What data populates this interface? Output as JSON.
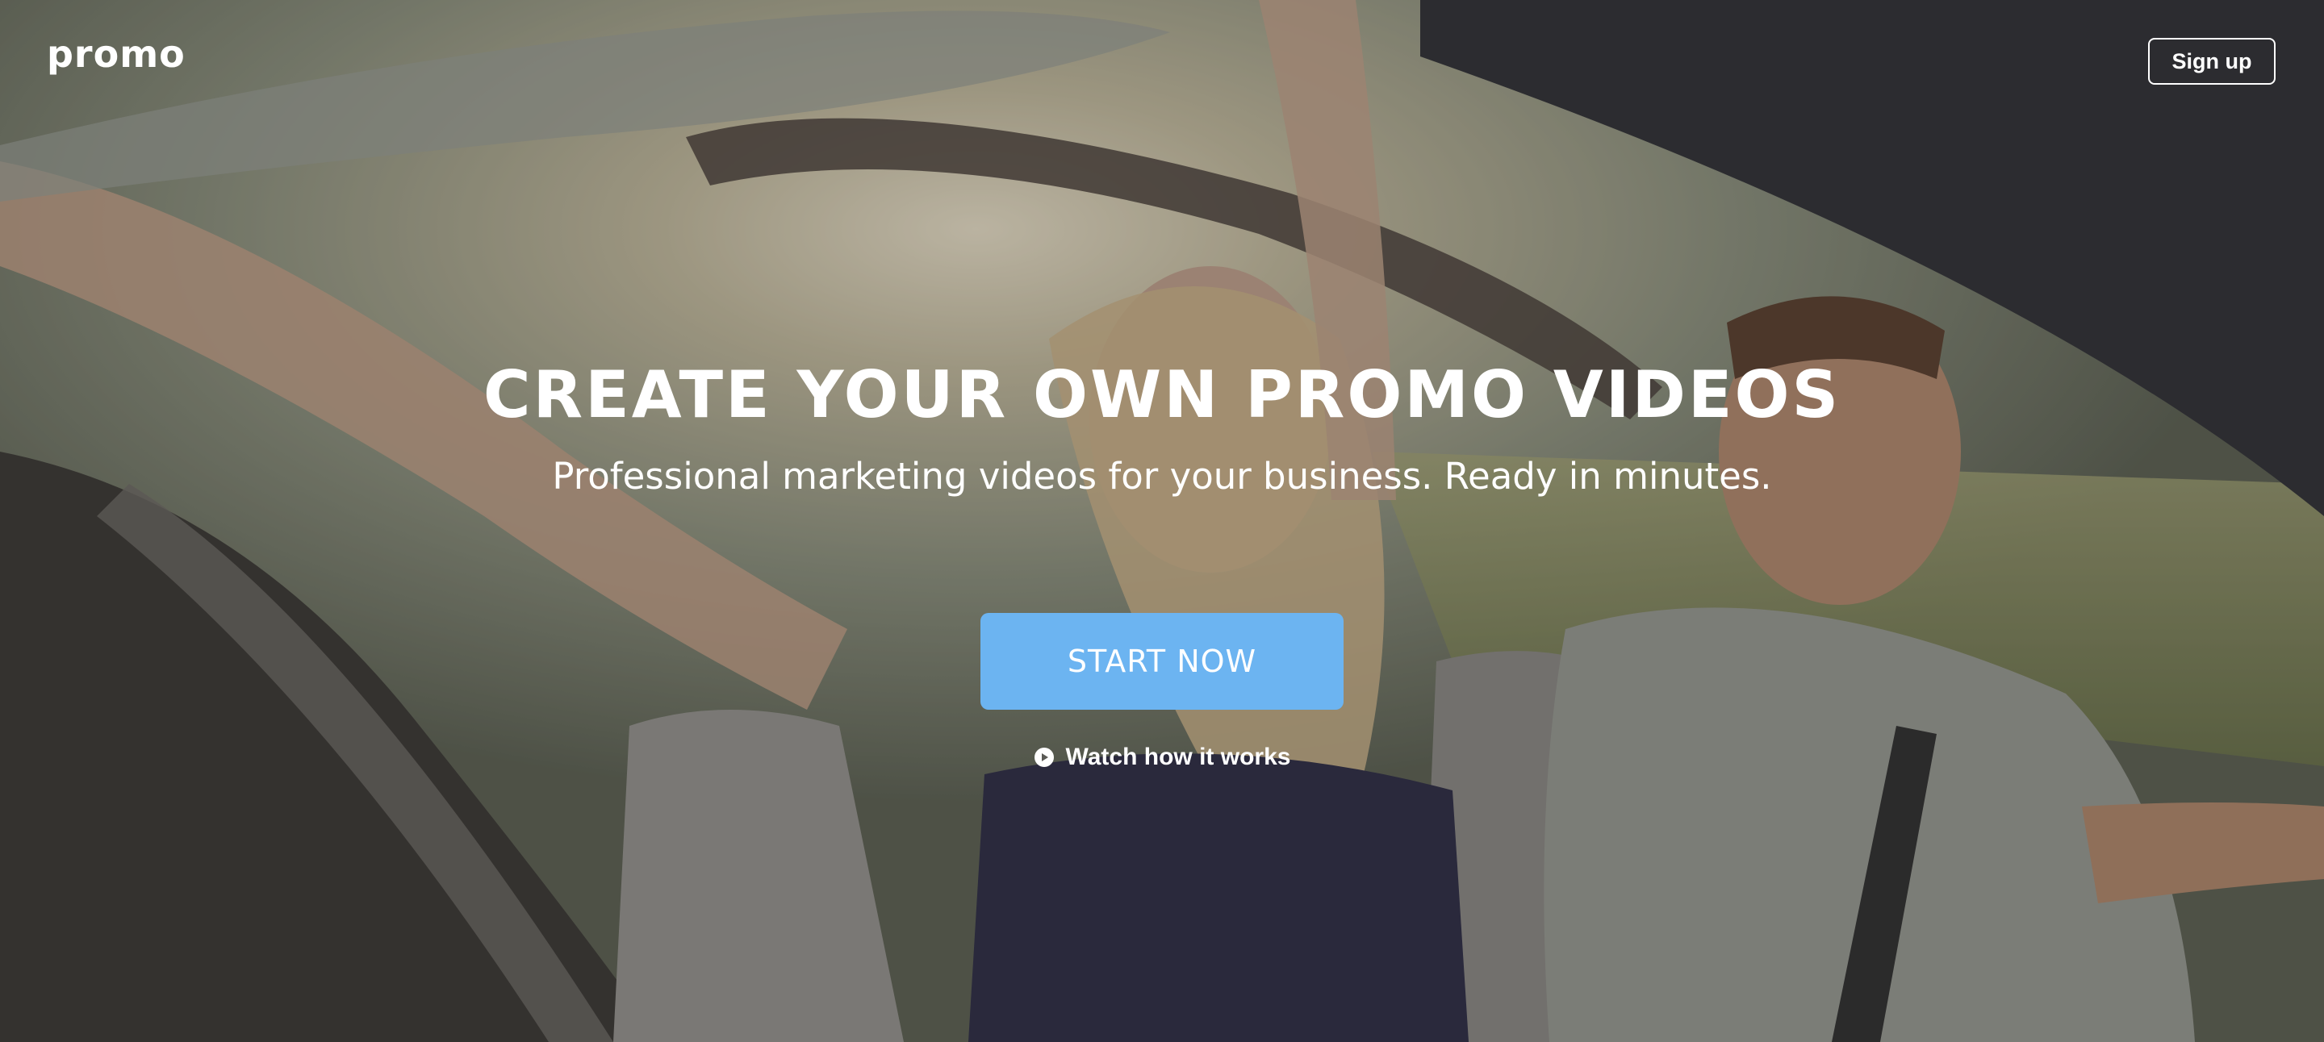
{
  "header": {
    "logo_text": "promo",
    "signup_label": "Sign up"
  },
  "hero": {
    "headline": "CREATE YOUR OWN PROMO VIDEOS",
    "subheadline": "Professional marketing videos for your business. Ready in minutes.",
    "cta_label": "START NOW",
    "watch_label": "Watch how it works",
    "background_image": "convertible-car-couple-driving-sunset"
  },
  "colors": {
    "accent": "#6cb4f1",
    "text": "#ffffff"
  },
  "icons": {
    "watch_icon": "play-circle-icon"
  }
}
